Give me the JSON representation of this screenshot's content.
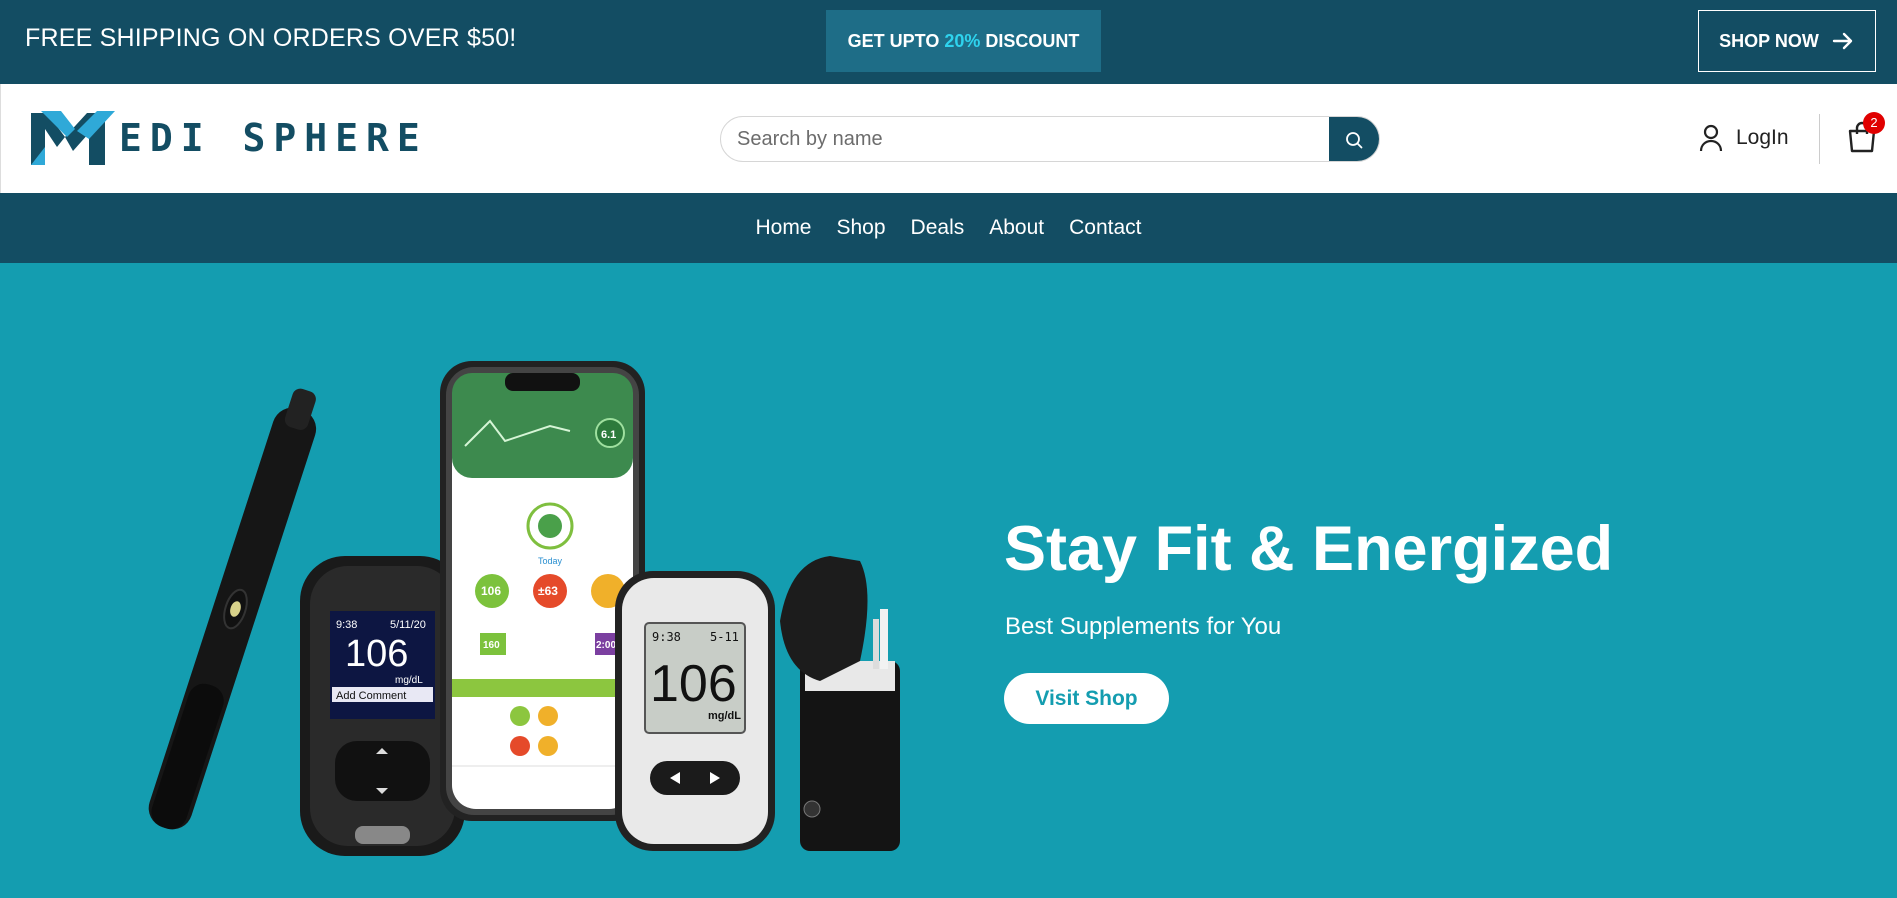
{
  "announcement": {
    "shipping_text": "FREE SHIPPING ON ORDERS OVER $50!",
    "discount_prefix": "GET UPTO ",
    "discount_value": "20%",
    "discount_suffix": " DISCOUNT",
    "shop_now_label": "SHOP NOW"
  },
  "header": {
    "logo_text": "EDI SPHERE",
    "search_placeholder": "Search by name",
    "login_label": "LogIn",
    "cart_count": "2"
  },
  "nav": {
    "items": [
      "Home",
      "Shop",
      "Deals",
      "About",
      "Contact"
    ]
  },
  "hero": {
    "title": "Stay Fit & Energized",
    "subtitle": "Best Supplements for You",
    "cta_label": "Visit Shop",
    "device_readings": {
      "meter_left_value": "106",
      "meter_left_unit": "mg/dL",
      "meter_left_time": "9:38",
      "meter_left_date": "5/11/20",
      "meter_left_comment": "Add Comment",
      "meter_right_value": "106",
      "meter_right_unit": "mg/dL",
      "meter_right_time": "9:38",
      "meter_right_date": "5-11",
      "phone_value_1": "106",
      "phone_value_2": "±63",
      "phone_value_3": "160",
      "phone_value_4": "2:00",
      "phone_value_5": "6.1",
      "phone_today": "Today"
    }
  },
  "colors": {
    "primary_dark": "#134d63",
    "hero_bg": "#149db0",
    "accent_cyan": "#2ed3ee",
    "badge_red": "#e00000"
  }
}
